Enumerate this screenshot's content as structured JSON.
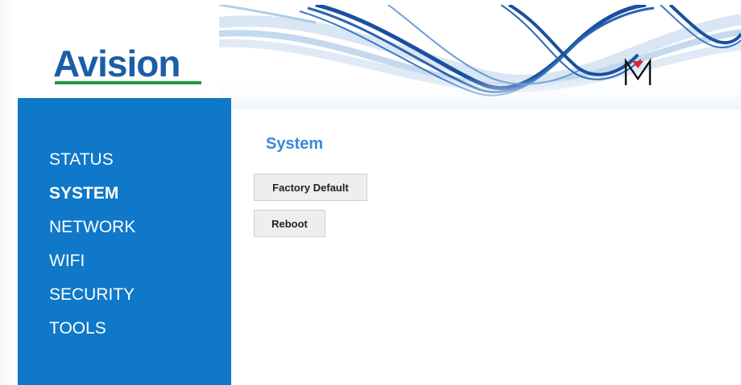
{
  "brand": {
    "logo_text": "Avision",
    "logo_color": "#1b5ea8",
    "logo_underline_color": "#1f9a3a",
    "mark_letter": "M",
    "mark_accent_color": "#e0262a"
  },
  "sidebar": {
    "background_color": "#0f78c8",
    "items": [
      {
        "label": "STATUS",
        "active": false
      },
      {
        "label": "SYSTEM",
        "active": true
      },
      {
        "label": "NETWORK",
        "active": false
      },
      {
        "label": "WIFI",
        "active": false
      },
      {
        "label": "SECURITY",
        "active": false
      },
      {
        "label": "TOOLS",
        "active": false
      }
    ]
  },
  "main": {
    "title": "System",
    "title_color": "#3a8ad6",
    "buttons": {
      "factory_default": "Factory Default",
      "reboot": "Reboot"
    }
  },
  "banner": {
    "icon": "blue-wave-banner",
    "wave_color": "#1a4fa0"
  }
}
